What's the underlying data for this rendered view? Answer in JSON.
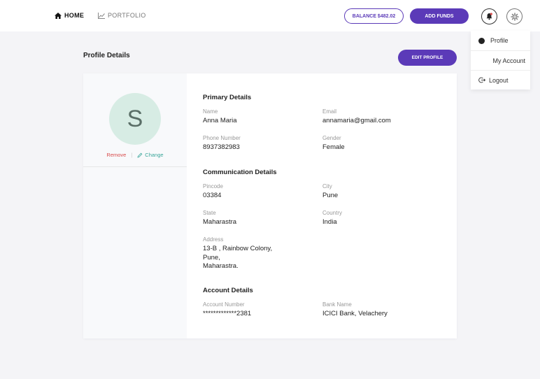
{
  "nav": {
    "home_label": "HOME",
    "portfolio_label": "PORTFOLIO"
  },
  "header": {
    "balance_label": "BALANCE $482.02",
    "add_funds_label": "ADD FUNDS"
  },
  "dropdown": {
    "items": [
      {
        "label": "Profile"
      },
      {
        "label": "My Account"
      },
      {
        "label": "Logout"
      }
    ]
  },
  "page": {
    "title": "Profile Details",
    "edit_label": "EDIT PROFILE"
  },
  "avatar": {
    "initial": "S",
    "remove_label": "Remove",
    "separator": "|",
    "change_label": "Change"
  },
  "primary": {
    "title": "Primary Details",
    "name_label": "Name",
    "name_value": "Anna Maria",
    "email_label": "Email",
    "email_value": "annamaria@gmail.com",
    "phone_label": "Phone Number",
    "phone_value": "8937382983",
    "gender_label": "Gender",
    "gender_value": "Female"
  },
  "communication": {
    "title": "Communication Details",
    "pincode_label": "Pincode",
    "pincode_value": "03384",
    "city_label": "City",
    "city_value": "Pune",
    "state_label": "State",
    "state_value": "Maharastra",
    "country_label": "Country",
    "country_value": "India",
    "address_label": "Address",
    "address_value": "13-B , Rainbow Colony,\nPune,\nMaharastra."
  },
  "account": {
    "title": "Account Details",
    "number_label": "Account Number",
    "number_value": "*************2381",
    "bank_label": "Bank Name",
    "bank_value": "ICICI Bank, Velachery"
  },
  "colors": {
    "accent": "#5b3ab8",
    "remove": "#d84b4b",
    "change": "#3aa69a",
    "avatar_bg": "#d7ece4"
  },
  "icons": [
    "home-icon",
    "chart-icon",
    "bell-icon",
    "gear-icon",
    "pencil-icon",
    "logout-icon"
  ]
}
